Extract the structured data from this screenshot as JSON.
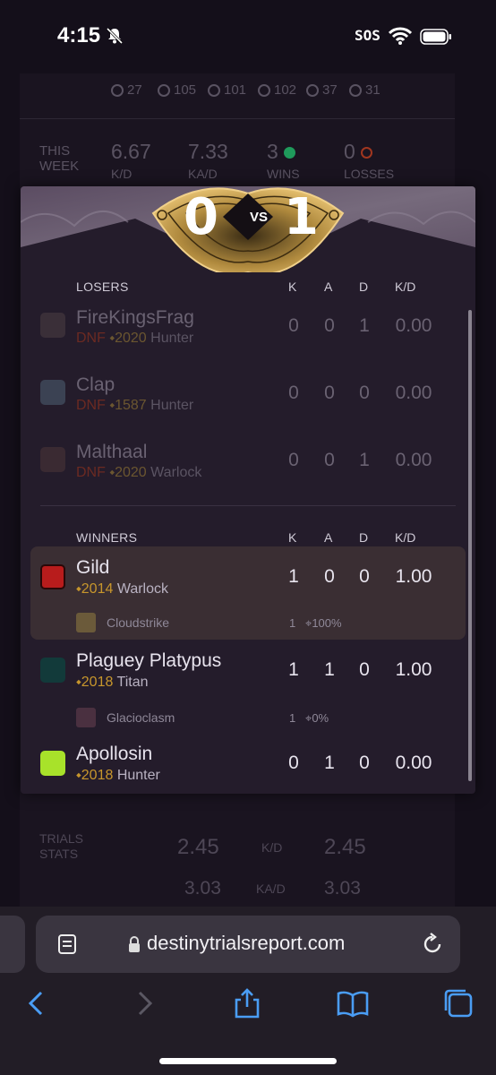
{
  "status_bar": {
    "time": "4:15",
    "sos": "SOS"
  },
  "background": {
    "stats": [
      "27",
      "105",
      "101",
      "102",
      "37",
      "31"
    ],
    "this_week": {
      "label_line1": "THIS",
      "label_line2": "WEEK",
      "kd": "6.67",
      "kd_label": "K/D",
      "kad": "7.33",
      "kad_label": "KA/D",
      "wins": "3",
      "wins_label": "WINS",
      "losses": "0",
      "losses_label": "LOSSES"
    },
    "trials": {
      "label_line1": "TRIALS",
      "label_line2": "STATS",
      "kd_left": "2.45",
      "kd_label": "K/D",
      "kd_right": "2.45",
      "kad_left": "3.03",
      "kad_label": "KA/D",
      "kad_right": "3.03"
    }
  },
  "match": {
    "score_left": "0",
    "vs": "VS",
    "score_right": "1",
    "columns": {
      "k": "K",
      "a": "A",
      "d": "D",
      "kd": "K/D"
    },
    "losers_label": "LOSERS",
    "winners_label": "WINNERS",
    "losers": [
      {
        "name": "FireKingsFrag",
        "status": "DNF",
        "light": "2020",
        "cls": "Hunter",
        "k": "0",
        "a": "0",
        "d": "1",
        "kd": "0.00",
        "avatar_color": "#3a2f38"
      },
      {
        "name": "Clap",
        "status": "DNF",
        "light": "1587",
        "cls": "Hunter",
        "k": "0",
        "a": "0",
        "d": "0",
        "kd": "0.00",
        "avatar_color": "#3b4253"
      },
      {
        "name": "Malthaal",
        "status": "DNF",
        "light": "2020",
        "cls": "Warlock",
        "k": "0",
        "a": "0",
        "d": "1",
        "kd": "0.00",
        "avatar_color": "#3a2a32"
      }
    ],
    "winners": [
      {
        "name": "Gild",
        "light": "2014",
        "cls": "Warlock",
        "k": "1",
        "a": "0",
        "d": "0",
        "kd": "1.00",
        "weapon": "Cloudstrike",
        "weapon_kills": "1",
        "weapon_acc": "100%",
        "avatar_color": "#b81c1c"
      },
      {
        "name": "Plaguey Platypus",
        "light": "2018",
        "cls": "Titan",
        "k": "1",
        "a": "1",
        "d": "0",
        "kd": "1.00",
        "weapon": "Glacioclasm",
        "weapon_kills": "1",
        "weapon_acc": "0%",
        "avatar_color": "#123a3a"
      },
      {
        "name": "Apollosin",
        "light": "2018",
        "cls": "Hunter",
        "k": "0",
        "a": "1",
        "d": "0",
        "kd": "0.00",
        "avatar_color": "#a8e22a"
      }
    ]
  },
  "browser": {
    "url": "destinytrialsreport.com"
  }
}
